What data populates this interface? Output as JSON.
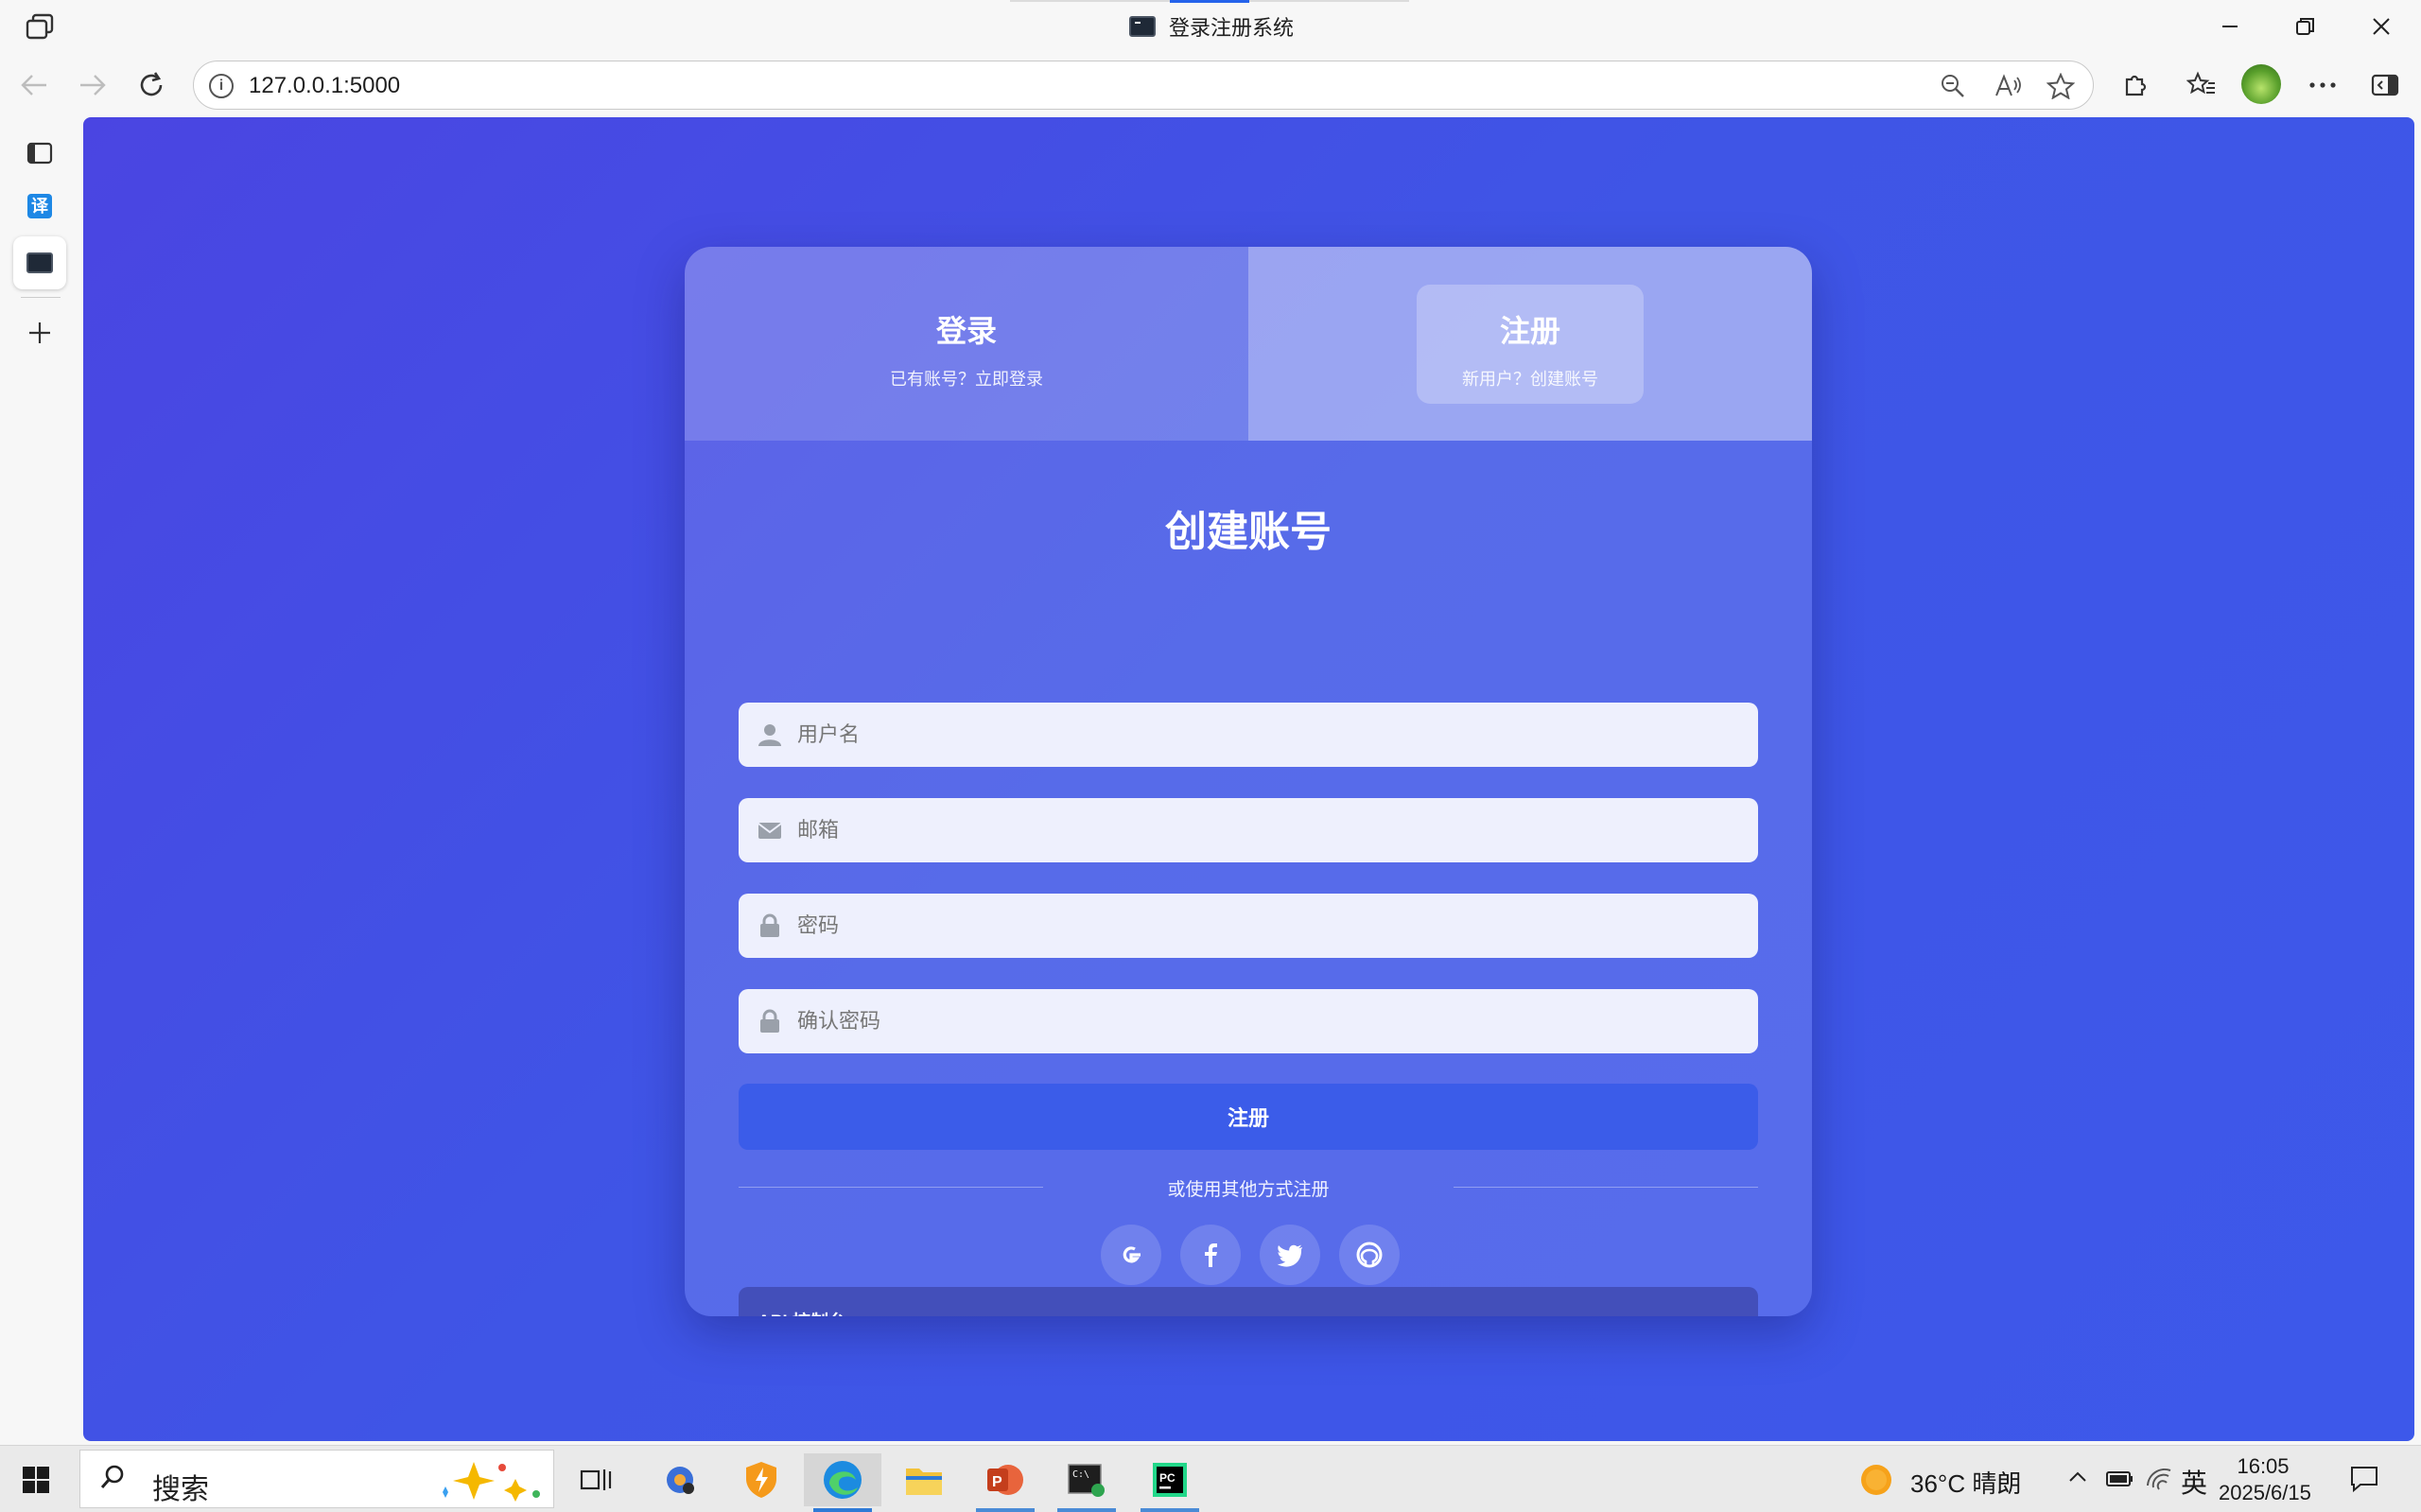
{
  "window": {
    "title": "登录注册系统"
  },
  "address_bar": {
    "url": "127.0.0.1:5000"
  },
  "sidebar": {
    "translate_icon_text": "译"
  },
  "page": {
    "tabs": {
      "login": {
        "title": "登录",
        "subtitle": "已有账号？立即登录"
      },
      "register": {
        "title": "注册",
        "subtitle": "新用户？创建账号"
      }
    },
    "form_title": "创建账号",
    "fields": {
      "username_placeholder": "用户名",
      "email_placeholder": "邮箱",
      "password_placeholder": "密码",
      "confirm_placeholder": "确认密码"
    },
    "submit_label": "注册",
    "divider_text": "或使用其他方式注册",
    "social": [
      "google-icon",
      "facebook-icon",
      "twitter-icon",
      "github-icon"
    ],
    "api_panel_title": "API 控制台"
  },
  "taskbar": {
    "search_label": "搜索",
    "weather": "36°C  晴朗",
    "ime": "英",
    "time": "16:05",
    "date": "2025/6/15"
  },
  "colors": {
    "page_bg": "#4350e6",
    "submit_bg": "#3b5ce9",
    "field_bg": "#eef0fd",
    "api_panel_bg": "#4652b8"
  }
}
